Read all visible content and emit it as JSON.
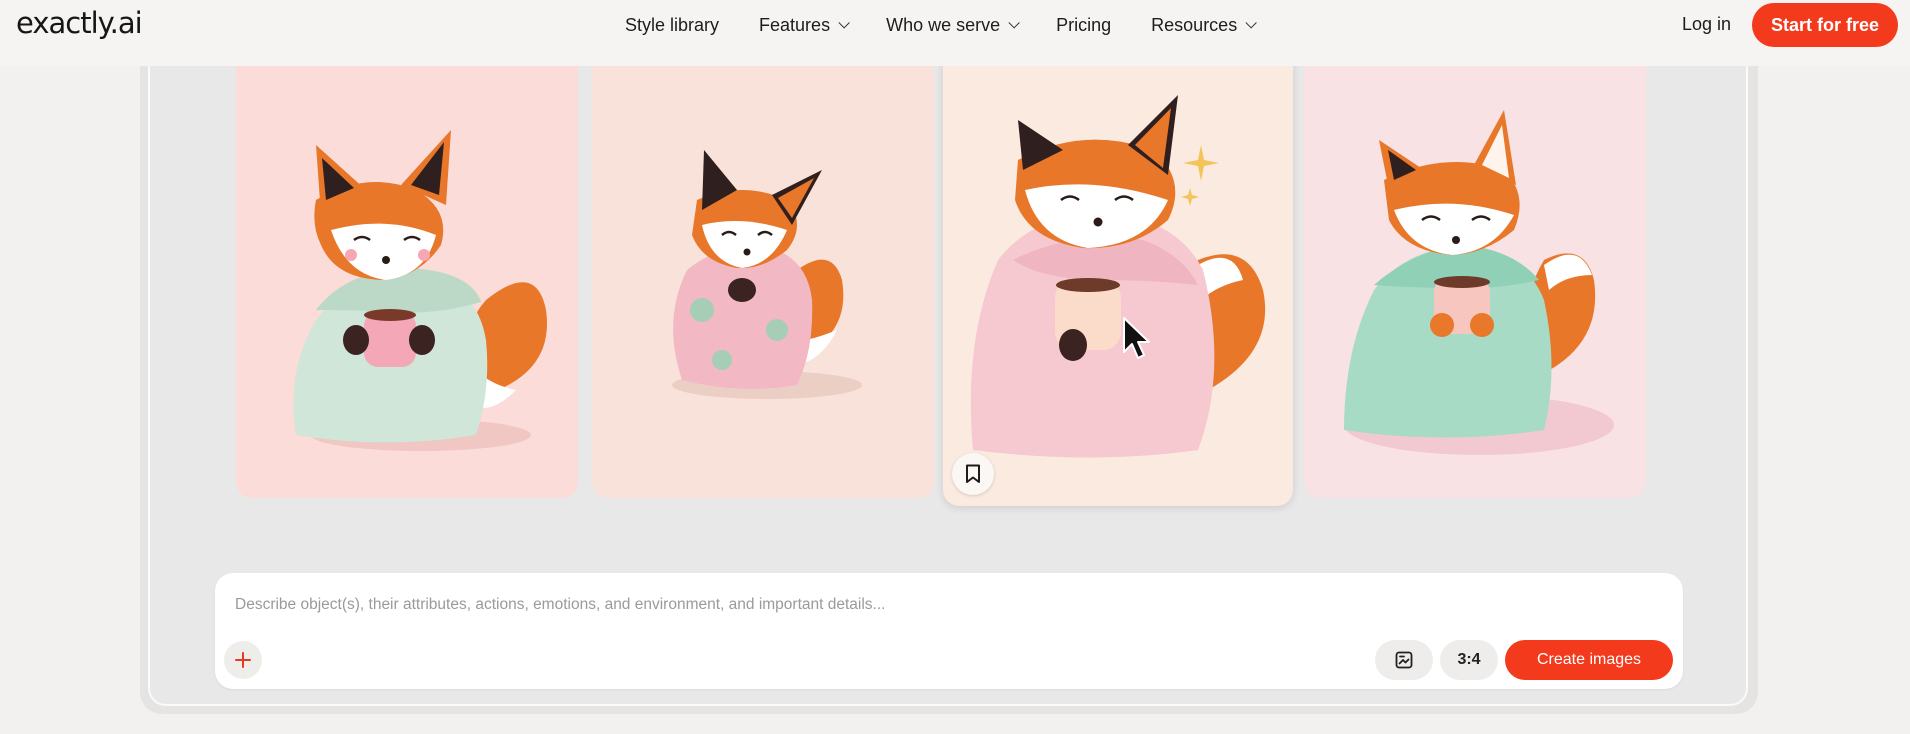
{
  "brand": {
    "logo_text": "exactly.ai",
    "accent_color": "#f33a1d"
  },
  "nav": {
    "links": [
      {
        "label": "Style library",
        "has_dropdown": false
      },
      {
        "label": "Features",
        "has_dropdown": true
      },
      {
        "label": "Who we serve",
        "has_dropdown": true
      },
      {
        "label": "Pricing",
        "has_dropdown": false
      },
      {
        "label": "Resources",
        "has_dropdown": true
      }
    ],
    "login_label": "Log in",
    "cta_label": "Start for free"
  },
  "gallery": {
    "images": [
      {
        "icon": "fox-illustration",
        "sweater_color": "#c9e2d3"
      },
      {
        "icon": "fox-illustration",
        "sweater_color": "#f0b8c4"
      },
      {
        "icon": "fox-illustration",
        "sweater_color": "#f5c6cc"
      },
      {
        "icon": "fox-illustration",
        "sweater_color": "#a7dbc6"
      }
    ],
    "hovered_index": 2,
    "hover_action_icon": "bookmark-icon"
  },
  "prompt": {
    "placeholder": "Describe object(s), their attributes, actions, emotions, and environment, and important details...",
    "value": "",
    "add_icon": "plus-icon",
    "style_icon": "image-style-icon",
    "aspect_ratio": "3:4",
    "create_label": "Create images"
  }
}
